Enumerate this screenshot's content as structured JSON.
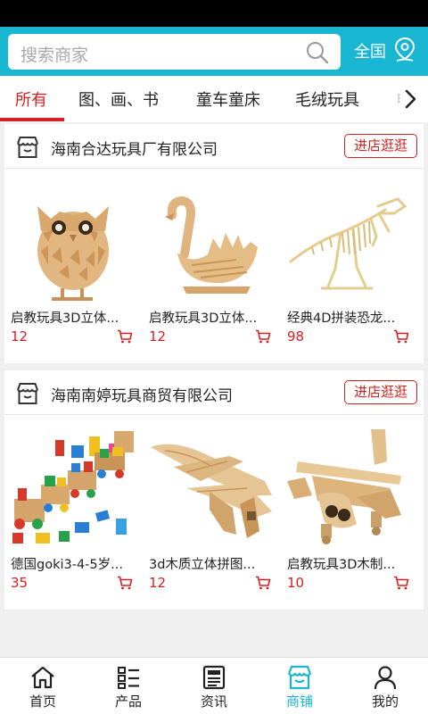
{
  "search": {
    "placeholder": "搜索商家"
  },
  "region": {
    "label": "全国"
  },
  "tabs": [
    {
      "label": "所有"
    },
    {
      "label": "图、画、书"
    },
    {
      "label": "童车童床"
    },
    {
      "label": "毛绒玩具"
    },
    {
      "label": "电"
    }
  ],
  "shops": [
    {
      "name": "海南合达玩具厂有限公司",
      "visit_label": "进店逛逛",
      "products": [
        {
          "title": "启教玩具3D立体...",
          "price": "12",
          "image": "wooden-owl"
        },
        {
          "title": "启教玩具3D立体...",
          "price": "12",
          "image": "wooden-swan"
        },
        {
          "title": "经典4D拼装恐龙...",
          "price": "98",
          "image": "dinosaur-skeleton"
        }
      ]
    },
    {
      "name": "海南南婷玩具商贸有限公司",
      "visit_label": "进店逛逛",
      "products": [
        {
          "title": "德国goki3-4-5岁...",
          "price": "35",
          "image": "wooden-train-blocks"
        },
        {
          "title": "3d木质立体拼图...",
          "price": "12",
          "image": "wooden-jet-plane"
        },
        {
          "title": "启教玩具3D木制...",
          "price": "10",
          "image": "wooden-airplane"
        }
      ]
    }
  ],
  "bottom_nav": [
    {
      "label": "首页",
      "icon": "home-icon"
    },
    {
      "label": "产品",
      "icon": "product-list-icon"
    },
    {
      "label": "资讯",
      "icon": "news-icon"
    },
    {
      "label": "商铺",
      "icon": "shop-icon",
      "active": true
    },
    {
      "label": "我的",
      "icon": "user-icon"
    }
  ],
  "colors": {
    "brand": "#19b6d2",
    "accent_red": "#d42020"
  }
}
